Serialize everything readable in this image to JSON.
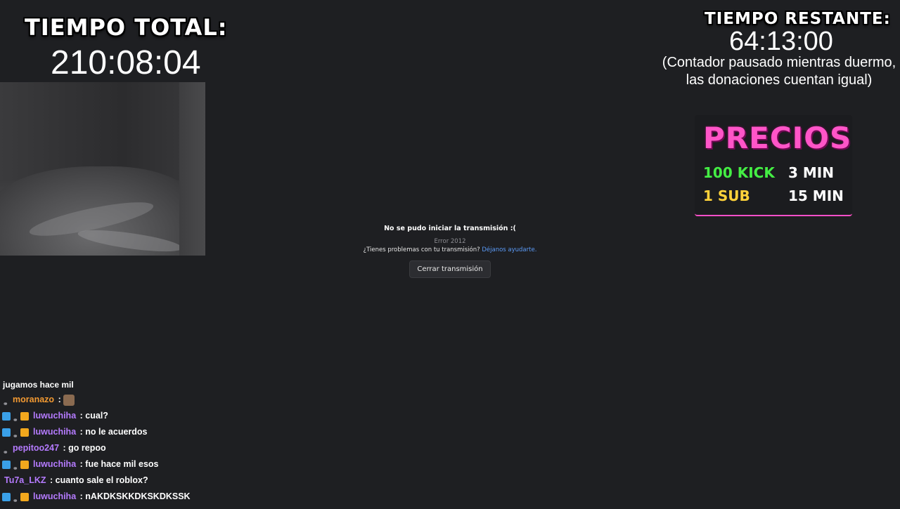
{
  "overlay": {
    "total_title": "TIEMPO TOTAL:",
    "total_time": "210:08:04",
    "remaining_title": "TIEMPO RESTANTE:",
    "remaining_time": "64:13:00",
    "remaining_note_line1": "(Contador pausado mientras duermo,",
    "remaining_note_line2": "las donaciones cuentan igual)"
  },
  "precios": {
    "title": "PRECIOS",
    "rows": [
      {
        "label": "100 KICK",
        "value": "3 MIN"
      },
      {
        "label": "1 SUB",
        "value": "15 MIN"
      }
    ]
  },
  "error": {
    "title": "No se pudo iniciar la transmisión :(",
    "code": "Error 2012",
    "help_text": "¿Tienes problemas con tu transmisión?",
    "help_link": "Déjanos ayudarte.",
    "close_button": "Cerrar transmisión"
  },
  "chat": {
    "messages": [
      {
        "user": "",
        "text": "jugamos hace mil"
      },
      {
        "user": "moranazo",
        "text": ": "
      },
      {
        "user": "luwuchiha",
        "text": ": cual?"
      },
      {
        "user": "luwuchiha",
        "text": ": no le acuerdos"
      },
      {
        "user": "pepitoo247",
        "text": ": go repoo"
      },
      {
        "user": "luwuchiha",
        "text": ": fue hace mil esos"
      },
      {
        "user": "Tu7a_LKZ",
        "text": ": cuanto sale el roblox?"
      },
      {
        "user": "luwuchiha",
        "text": ": nAKDKSKKDKSKDKSSK"
      }
    ]
  }
}
